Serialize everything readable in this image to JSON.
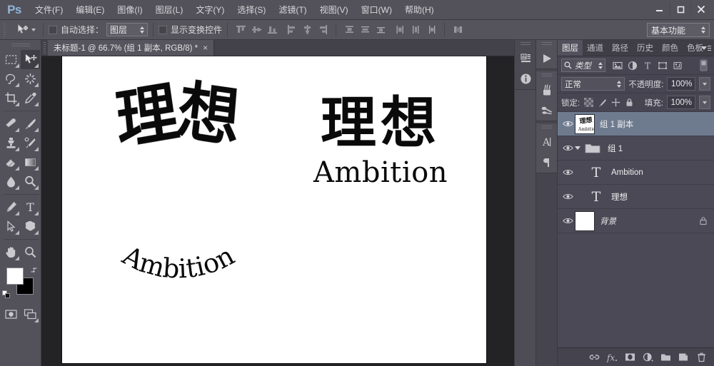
{
  "app": {
    "name": "Ps",
    "logo_label": "Ps"
  },
  "menubar": {
    "items": [
      {
        "label": "文件(F)",
        "name": "menu-file"
      },
      {
        "label": "编辑(E)",
        "name": "menu-edit"
      },
      {
        "label": "图像(I)",
        "name": "menu-image"
      },
      {
        "label": "图层(L)",
        "name": "menu-layer"
      },
      {
        "label": "文字(Y)",
        "name": "menu-type"
      },
      {
        "label": "选择(S)",
        "name": "menu-select"
      },
      {
        "label": "滤镜(T)",
        "name": "menu-filter"
      },
      {
        "label": "视图(V)",
        "name": "menu-view"
      },
      {
        "label": "窗口(W)",
        "name": "menu-window"
      },
      {
        "label": "帮助(H)",
        "name": "menu-help"
      }
    ],
    "window_controls": {
      "minimize": "minimize-icon",
      "maximize": "maximize-icon",
      "close": "close-icon"
    }
  },
  "options_bar": {
    "tool": "move-tool",
    "auto_select_label": "自动选择：",
    "auto_select_checked": false,
    "auto_select_target": "图层",
    "show_transform_label": "显示变换控件",
    "show_transform_checked": false,
    "align_buttons": [
      "align-top-edges",
      "align-vertical-centers",
      "align-bottom-edges",
      "align-left-edges",
      "align-horizontal-centers",
      "align-right-edges"
    ],
    "distribute_buttons": [
      "distribute-top-edges",
      "distribute-vertical-centers",
      "distribute-bottom-edges",
      "distribute-left-edges",
      "distribute-horizontal-centers",
      "distribute-right-edges"
    ],
    "auto_align_button": "auto-align-layers",
    "workspace": "基本功能"
  },
  "document": {
    "tab_title": "未标题-1 @ 66.7% (组 1 副本, RGB/8) *",
    "close_glyph": "×",
    "zoom": "66.7%",
    "color_mode": "RGB/8",
    "artwork": {
      "warped_chinese": "理想",
      "warped_english": "Ambition",
      "plain_chinese": "理想",
      "plain_english": "Ambition"
    }
  },
  "dock_left": {
    "buttons": [
      {
        "name": "histogram-icon",
        "label": "直方图"
      },
      {
        "name": "info-icon",
        "label": "信息"
      }
    ]
  },
  "dock_right": {
    "buttons": [
      {
        "name": "actions-play-icon",
        "label": "动作"
      },
      {
        "name": "brush-icon",
        "label": "画笔"
      },
      {
        "name": "brush-presets-icon",
        "label": "画笔预设"
      },
      {
        "name": "character-icon",
        "label": "字符"
      },
      {
        "name": "paragraph-icon",
        "label": "段落"
      }
    ]
  },
  "layers_panel": {
    "tabs": [
      {
        "label": "图层",
        "active": true
      },
      {
        "label": "通道",
        "active": false
      },
      {
        "label": "路径",
        "active": false
      },
      {
        "label": "历史",
        "active": false
      },
      {
        "label": "颜色",
        "active": false
      },
      {
        "label": "色板",
        "active": false
      }
    ],
    "filter": {
      "kind_label": "类型",
      "icons": [
        "filter-pixel-icon",
        "filter-adjustment-icon",
        "filter-type-icon",
        "filter-shape-icon",
        "filter-smartobject-icon"
      ],
      "toggle": "filter-toggle-icon"
    },
    "blend_mode": "正常",
    "opacity_label": "不透明度:",
    "opacity_value": "100%",
    "lock_label": "锁定:",
    "lock_icons": [
      "lock-transparent-pixels-icon",
      "lock-image-pixels-icon",
      "lock-position-icon",
      "lock-all-icon"
    ],
    "fill_label": "填充:",
    "fill_value": "100%",
    "layers": [
      {
        "name": "组 1 副本",
        "type": "group-merged",
        "selected": true,
        "visible": true,
        "indent": 0,
        "locked": false
      },
      {
        "name": "组 1",
        "type": "group",
        "selected": false,
        "visible": true,
        "indent": 0,
        "locked": false,
        "expanded": true
      },
      {
        "name": "Ambition",
        "type": "text",
        "selected": false,
        "visible": true,
        "indent": 1,
        "locked": false
      },
      {
        "name": "理想",
        "type": "text",
        "selected": false,
        "visible": true,
        "indent": 1,
        "locked": false
      },
      {
        "name": "背景",
        "type": "background",
        "selected": false,
        "visible": true,
        "indent": 0,
        "locked": true
      }
    ],
    "bottom_buttons": [
      {
        "name": "link-layers-icon",
        "label": "链接图层"
      },
      {
        "name": "layer-style-fx-icon",
        "label": "fx"
      },
      {
        "name": "add-layer-mask-icon",
        "label": "添加图层蒙版"
      },
      {
        "name": "new-adjustment-layer-icon",
        "label": "新建调整图层"
      },
      {
        "name": "new-group-icon",
        "label": "创建新组"
      },
      {
        "name": "new-layer-icon",
        "label": "创建新图层"
      },
      {
        "name": "delete-layer-icon",
        "label": "删除图层"
      }
    ]
  },
  "toolbar": {
    "tools": [
      {
        "name": "rectangular-marquee-tool",
        "active": false,
        "has_flyout": true
      },
      {
        "name": "move-tool",
        "active": true,
        "has_flyout": true
      },
      {
        "name": "lasso-tool",
        "active": false,
        "has_flyout": true
      },
      {
        "name": "magic-wand-tool",
        "active": false,
        "has_flyout": true
      },
      {
        "name": "crop-tool",
        "active": false,
        "has_flyout": true
      },
      {
        "name": "eyedropper-tool",
        "active": false,
        "has_flyout": true
      },
      {
        "name": "spot-healing-brush-tool",
        "active": false,
        "has_flyout": true
      },
      {
        "name": "brush-tool",
        "active": false,
        "has_flyout": true
      },
      {
        "name": "clone-stamp-tool",
        "active": false,
        "has_flyout": true
      },
      {
        "name": "history-brush-tool",
        "active": false,
        "has_flyout": true
      },
      {
        "name": "eraser-tool",
        "active": false,
        "has_flyout": true
      },
      {
        "name": "gradient-tool",
        "active": false,
        "has_flyout": true
      },
      {
        "name": "blur-tool",
        "active": false,
        "has_flyout": true
      },
      {
        "name": "dodge-tool",
        "active": false,
        "has_flyout": true
      },
      {
        "name": "pen-tool",
        "active": false,
        "has_flyout": true
      },
      {
        "name": "horizontal-type-tool",
        "active": false,
        "has_flyout": true
      },
      {
        "name": "path-selection-tool",
        "active": false,
        "has_flyout": true
      },
      {
        "name": "custom-shape-tool",
        "active": false,
        "has_flyout": true
      },
      {
        "name": "hand-tool",
        "active": false,
        "has_flyout": true
      },
      {
        "name": "zoom-tool",
        "active": false,
        "has_flyout": false
      }
    ],
    "foreground_color": "#ffffff",
    "background_color": "#000000",
    "swap_colors": "swap-colors-icon",
    "default_colors": "default-colors-icon",
    "quick_mask": "quick-mask-icon",
    "screen_mode": "screen-mode-icon"
  },
  "colors": {
    "chrome": "#53515a",
    "panel": "#464551",
    "canvas_backdrop": "#232326",
    "selection_blue": "#6e7b8f",
    "accent_logo": "#8fb6d8",
    "artwork_ink": "#0a0a0a",
    "paper": "#ffffff"
  }
}
